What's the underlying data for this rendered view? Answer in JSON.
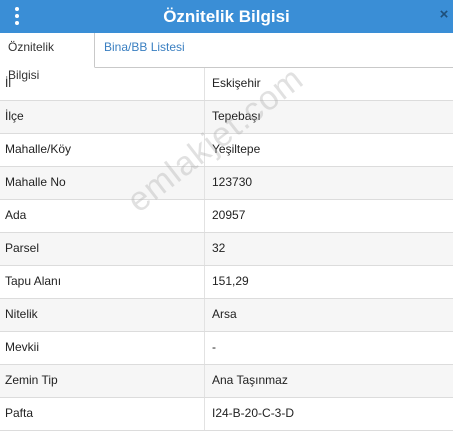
{
  "window": {
    "title": "Öznitelik Bilgisi",
    "close_glyph": "×"
  },
  "tabs": [
    {
      "label": "Öznitelik Bilgisi",
      "active": true
    },
    {
      "label": "Bina/BB Listesi",
      "active": false
    }
  ],
  "properties": [
    {
      "key": "İl",
      "value": "Eskişehir"
    },
    {
      "key": "İlçe",
      "value": "Tepebaşı"
    },
    {
      "key": "Mahalle/Köy",
      "value": "Yeşiltepe"
    },
    {
      "key": "Mahalle No",
      "value": "123730"
    },
    {
      "key": "Ada",
      "value": "20957"
    },
    {
      "key": "Parsel",
      "value": "32"
    },
    {
      "key": "Tapu Alanı",
      "value": "151,29"
    },
    {
      "key": "Nitelik",
      "value": "Arsa"
    },
    {
      "key": "Mevkii",
      "value": "-"
    },
    {
      "key": "Zemin Tip",
      "value": "Ana Taşınmaz"
    },
    {
      "key": "Pafta",
      "value": "I24-B-20-C-3-D"
    }
  ],
  "watermark": "emlakjet.com",
  "colors": {
    "titlebar": "#3a8ed6",
    "tab_link": "#3a7fc1"
  }
}
